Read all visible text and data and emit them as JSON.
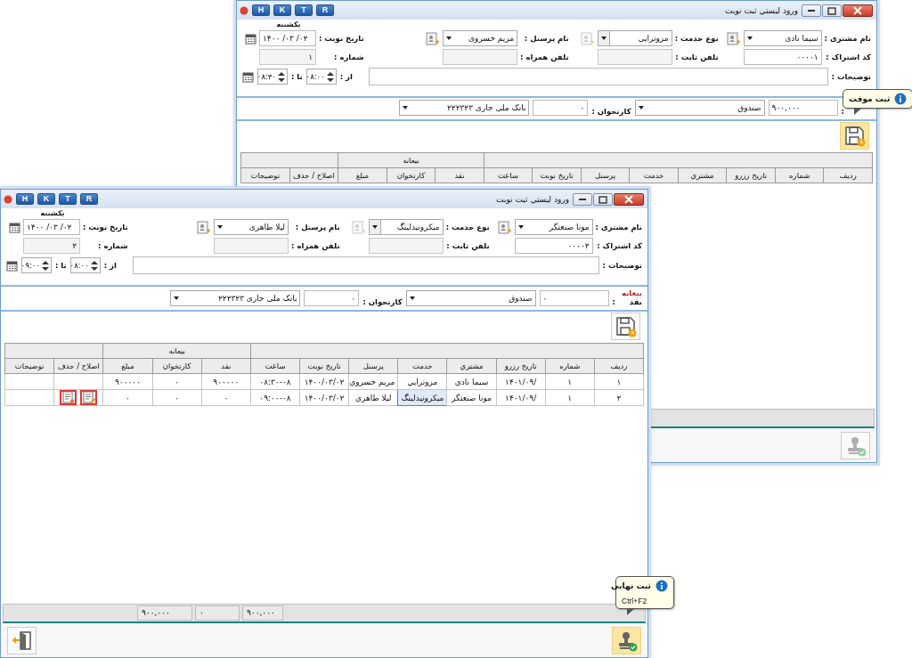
{
  "windows": [
    {
      "kind": "back",
      "title": "ورود لیستي ثبت نوبت",
      "quick_buttons": [
        "R",
        "T",
        "K",
        "H"
      ],
      "form": {
        "customer_label": "نام مشتری :",
        "customer": "سیما نادی",
        "service_label": "نوع خدمت :",
        "service": "مزوترایی",
        "staff_label": "نام پرسنل :",
        "staff": "مریم خسروی",
        "weekday": "یکشنبه",
        "date_label": "تاریخ نوبت :",
        "date": "۱۴۰۰ /۰۳ /۰۲",
        "subscription_label": "کد اشتراک :",
        "subscription": "۰۰۰۰۱",
        "phone_label": "تلفن ثابت :",
        "mobile_label": "تلفن همراه :",
        "number_label": "شماره :",
        "number": "۱",
        "notes_label": "توضیحات :",
        "from_label": "از :",
        "from": "۰۸:۰۰",
        "to_label": "تا :",
        "to": "۰۸:۳۰"
      },
      "deposit": {
        "colon": ":",
        "cash": "۹۰۰,۰۰۰",
        "fund": "صندوق",
        "card_label": "کارتخوان :",
        "card": "۰",
        "bank": "بانک ملی جاری ۲۲۲۳۲۳"
      },
      "save_button": {
        "highlighted": true,
        "tooltip": "ثبت موقت"
      },
      "table": {
        "group_header": "بیعانه",
        "columns": [
          "ردیف",
          "شماره",
          "تاریخ رزرو",
          "مشتري",
          "خدمت",
          "پرسنل",
          "تاریخ نوبت",
          "ساعت",
          "نقد",
          "کارتخوان",
          "مبلغ",
          "اصلاح / حذف",
          "توضیحات"
        ]
      },
      "final_button": {
        "disabled": true,
        "highlighted": false
      }
    },
    {
      "kind": "front",
      "title": "ورود لیستي ثبت نوبت",
      "quick_buttons": [
        "R",
        "T",
        "K",
        "H"
      ],
      "form": {
        "customer_label": "نام مشتری :",
        "customer": "مونا صنعتگر",
        "service_label": "نوع خدمت :",
        "service": "میکرونیدلینگ",
        "staff_label": "نام پرسنل :",
        "staff": "لیلا طاهری",
        "weekday": "یکشنبه",
        "date_label": "تاریخ نوبت :",
        "date": "۱۴۰۰ /۰۳ /۰۲",
        "subscription_label": "کد اشتراک :",
        "subscription": "۰۰۰۰۲",
        "phone_label": "تلفن ثابت :",
        "mobile_label": "تلفن همراه :",
        "number_label": "شماره :",
        "number": "۲",
        "notes_label": "توضیحات :",
        "from_label": "از :",
        "from": "۰۸:۰۰",
        "to_label": "تا :",
        "to": "۰۹:۰۰"
      },
      "deposit": {
        "title": "بیعانه",
        "cash_label": "نقد",
        "colon": ":",
        "cash": "۰",
        "fund": "صندوق",
        "card_label": "کارتخوان :",
        "card": "۰",
        "bank": "بانک ملی جاری ۲۲۲۳۲۳"
      },
      "save_button": {
        "highlighted": false
      },
      "table": {
        "group_header": "بیعانه",
        "columns": [
          "ردیف",
          "شماره",
          "تاریخ رزرو",
          "مشتري",
          "خدمت",
          "پرسنل",
          "تاریخ نوبت",
          "ساعت",
          "نقد",
          "کارتخوان",
          "مبلغ",
          "اصلاح / حذف",
          "توضیحات"
        ],
        "rows": [
          {
            "cells": [
              "۱",
              "۱",
              "۱۴۰۱/۰۹/",
              "سیما نادي",
              "مزوتراپي",
              "مریم خسروي",
              "۱۴۰۰/۰۳/۰۲",
              "۰۸:۳۰-۰۸",
              "۹۰۰۰۰۰",
              "۰",
              "۹۰۰۰۰۰",
              "",
              ""
            ],
            "selected": false,
            "actions": false
          },
          {
            "cells": [
              "۲",
              "۱",
              "۱۴۰۱/۰۹/",
              "مونا صنعتگر",
              "میکرونیدلینگ",
              "لیلا طاهري",
              "۱۴۰۰/۰۳/۰۲",
              "۰۹:۰۰-۰۸",
              "۰",
              "۰",
              "۰",
              "",
              ""
            ],
            "selected": true,
            "actions": true
          }
        ]
      },
      "totals": [
        "۹۰۰,۰۰۰",
        "۰",
        "۹۰۰,۰۰۰"
      ],
      "final_button": {
        "disabled": false,
        "highlighted": true,
        "tooltip": "ثبت نهایی",
        "shortcut": "Ctrl+F2"
      },
      "exit_button": true
    }
  ]
}
